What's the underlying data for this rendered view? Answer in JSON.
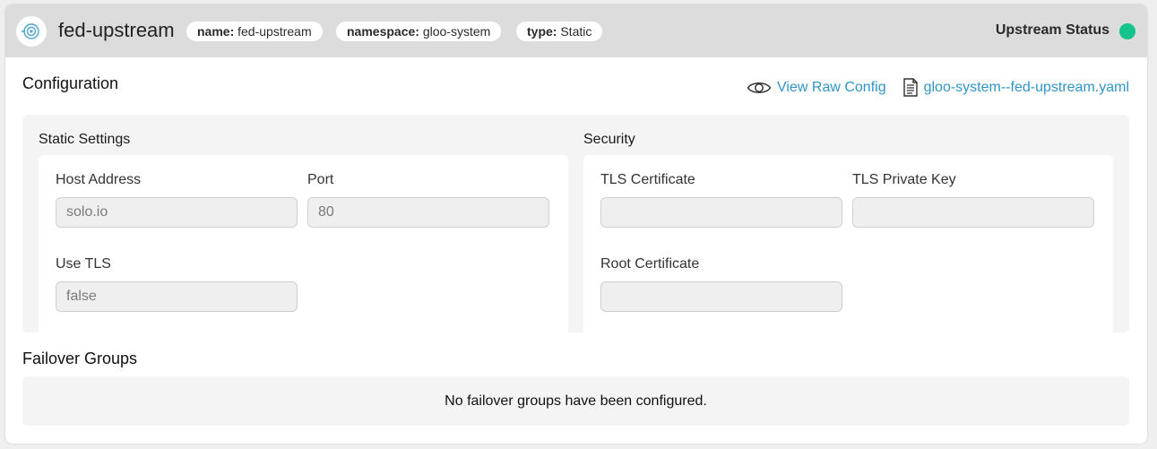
{
  "header": {
    "title": "fed-upstream",
    "logo_icon": "upstream-target-icon",
    "tags": [
      {
        "key": "name:",
        "value": "fed-upstream"
      },
      {
        "key": "namespace:",
        "value": "gloo-system"
      },
      {
        "key": "type:",
        "value": "Static"
      }
    ],
    "status_label": "Upstream Status",
    "status_color": "#13c38b"
  },
  "configuration": {
    "title": "Configuration",
    "view_raw_config": "View Raw Config",
    "view_raw_icon": "eye-icon",
    "yaml_file": "gloo-system--fed-upstream.yaml",
    "yaml_icon": "document-icon",
    "accent_color": "#2f95c9"
  },
  "static_settings": {
    "title": "Static Settings",
    "host_address": {
      "label": "Host Address",
      "value": "solo.io"
    },
    "port": {
      "label": "Port",
      "value": "80"
    },
    "use_tls": {
      "label": "Use TLS",
      "value": "false"
    }
  },
  "security": {
    "title": "Security",
    "tls_certificate": {
      "label": "TLS Certificate",
      "value": ""
    },
    "tls_private_key": {
      "label": "TLS Private Key",
      "value": ""
    },
    "root_certificate": {
      "label": "Root Certificate",
      "value": ""
    }
  },
  "failover": {
    "title": "Failover Groups",
    "empty_message": "No failover groups have been configured."
  }
}
